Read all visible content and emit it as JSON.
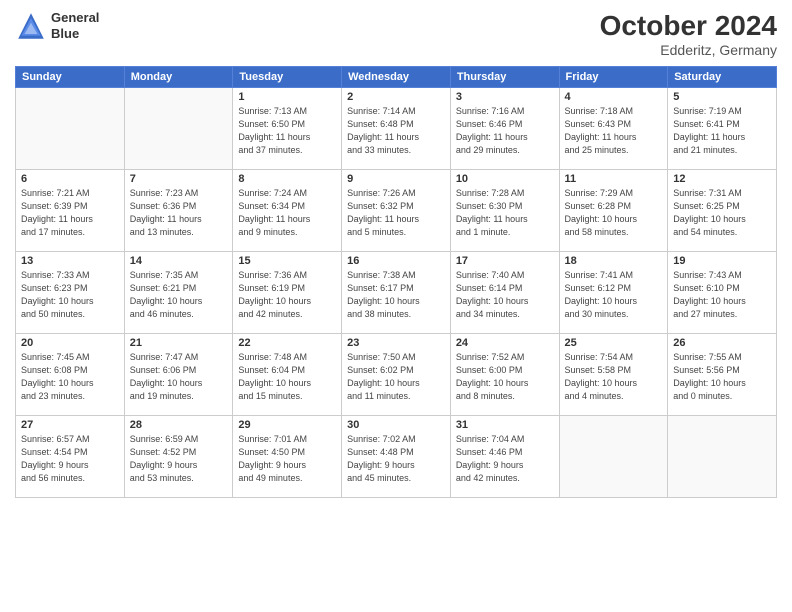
{
  "header": {
    "logo_line1": "General",
    "logo_line2": "Blue",
    "month": "October 2024",
    "location": "Edderitz, Germany"
  },
  "days_of_week": [
    "Sunday",
    "Monday",
    "Tuesday",
    "Wednesday",
    "Thursday",
    "Friday",
    "Saturday"
  ],
  "weeks": [
    [
      {
        "day": "",
        "detail": ""
      },
      {
        "day": "",
        "detail": ""
      },
      {
        "day": "1",
        "detail": "Sunrise: 7:13 AM\nSunset: 6:50 PM\nDaylight: 11 hours\nand 37 minutes."
      },
      {
        "day": "2",
        "detail": "Sunrise: 7:14 AM\nSunset: 6:48 PM\nDaylight: 11 hours\nand 33 minutes."
      },
      {
        "day": "3",
        "detail": "Sunrise: 7:16 AM\nSunset: 6:46 PM\nDaylight: 11 hours\nand 29 minutes."
      },
      {
        "day": "4",
        "detail": "Sunrise: 7:18 AM\nSunset: 6:43 PM\nDaylight: 11 hours\nand 25 minutes."
      },
      {
        "day": "5",
        "detail": "Sunrise: 7:19 AM\nSunset: 6:41 PM\nDaylight: 11 hours\nand 21 minutes."
      }
    ],
    [
      {
        "day": "6",
        "detail": "Sunrise: 7:21 AM\nSunset: 6:39 PM\nDaylight: 11 hours\nand 17 minutes."
      },
      {
        "day": "7",
        "detail": "Sunrise: 7:23 AM\nSunset: 6:36 PM\nDaylight: 11 hours\nand 13 minutes."
      },
      {
        "day": "8",
        "detail": "Sunrise: 7:24 AM\nSunset: 6:34 PM\nDaylight: 11 hours\nand 9 minutes."
      },
      {
        "day": "9",
        "detail": "Sunrise: 7:26 AM\nSunset: 6:32 PM\nDaylight: 11 hours\nand 5 minutes."
      },
      {
        "day": "10",
        "detail": "Sunrise: 7:28 AM\nSunset: 6:30 PM\nDaylight: 11 hours\nand 1 minute."
      },
      {
        "day": "11",
        "detail": "Sunrise: 7:29 AM\nSunset: 6:28 PM\nDaylight: 10 hours\nand 58 minutes."
      },
      {
        "day": "12",
        "detail": "Sunrise: 7:31 AM\nSunset: 6:25 PM\nDaylight: 10 hours\nand 54 minutes."
      }
    ],
    [
      {
        "day": "13",
        "detail": "Sunrise: 7:33 AM\nSunset: 6:23 PM\nDaylight: 10 hours\nand 50 minutes."
      },
      {
        "day": "14",
        "detail": "Sunrise: 7:35 AM\nSunset: 6:21 PM\nDaylight: 10 hours\nand 46 minutes."
      },
      {
        "day": "15",
        "detail": "Sunrise: 7:36 AM\nSunset: 6:19 PM\nDaylight: 10 hours\nand 42 minutes."
      },
      {
        "day": "16",
        "detail": "Sunrise: 7:38 AM\nSunset: 6:17 PM\nDaylight: 10 hours\nand 38 minutes."
      },
      {
        "day": "17",
        "detail": "Sunrise: 7:40 AM\nSunset: 6:14 PM\nDaylight: 10 hours\nand 34 minutes."
      },
      {
        "day": "18",
        "detail": "Sunrise: 7:41 AM\nSunset: 6:12 PM\nDaylight: 10 hours\nand 30 minutes."
      },
      {
        "day": "19",
        "detail": "Sunrise: 7:43 AM\nSunset: 6:10 PM\nDaylight: 10 hours\nand 27 minutes."
      }
    ],
    [
      {
        "day": "20",
        "detail": "Sunrise: 7:45 AM\nSunset: 6:08 PM\nDaylight: 10 hours\nand 23 minutes."
      },
      {
        "day": "21",
        "detail": "Sunrise: 7:47 AM\nSunset: 6:06 PM\nDaylight: 10 hours\nand 19 minutes."
      },
      {
        "day": "22",
        "detail": "Sunrise: 7:48 AM\nSunset: 6:04 PM\nDaylight: 10 hours\nand 15 minutes."
      },
      {
        "day": "23",
        "detail": "Sunrise: 7:50 AM\nSunset: 6:02 PM\nDaylight: 10 hours\nand 11 minutes."
      },
      {
        "day": "24",
        "detail": "Sunrise: 7:52 AM\nSunset: 6:00 PM\nDaylight: 10 hours\nand 8 minutes."
      },
      {
        "day": "25",
        "detail": "Sunrise: 7:54 AM\nSunset: 5:58 PM\nDaylight: 10 hours\nand 4 minutes."
      },
      {
        "day": "26",
        "detail": "Sunrise: 7:55 AM\nSunset: 5:56 PM\nDaylight: 10 hours\nand 0 minutes."
      }
    ],
    [
      {
        "day": "27",
        "detail": "Sunrise: 6:57 AM\nSunset: 4:54 PM\nDaylight: 9 hours\nand 56 minutes."
      },
      {
        "day": "28",
        "detail": "Sunrise: 6:59 AM\nSunset: 4:52 PM\nDaylight: 9 hours\nand 53 minutes."
      },
      {
        "day": "29",
        "detail": "Sunrise: 7:01 AM\nSunset: 4:50 PM\nDaylight: 9 hours\nand 49 minutes."
      },
      {
        "day": "30",
        "detail": "Sunrise: 7:02 AM\nSunset: 4:48 PM\nDaylight: 9 hours\nand 45 minutes."
      },
      {
        "day": "31",
        "detail": "Sunrise: 7:04 AM\nSunset: 4:46 PM\nDaylight: 9 hours\nand 42 minutes."
      },
      {
        "day": "",
        "detail": ""
      },
      {
        "day": "",
        "detail": ""
      }
    ]
  ]
}
